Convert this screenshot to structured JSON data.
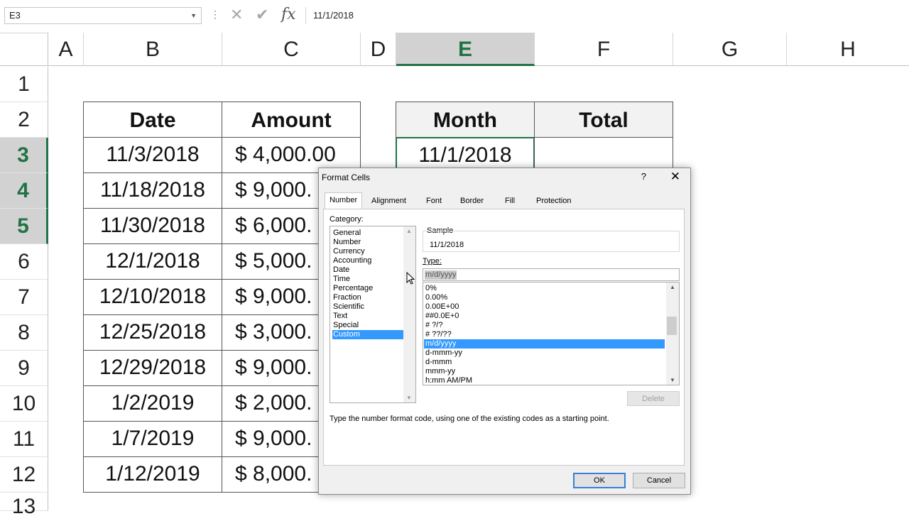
{
  "formula_bar": {
    "name_box": "E3",
    "formula": "11/1/2018",
    "icons": [
      "more-icon",
      "cancel-icon",
      "enter-icon",
      "fx-icon"
    ]
  },
  "columns": [
    "A",
    "B",
    "C",
    "D",
    "E",
    "F",
    "G",
    "H"
  ],
  "selected_column": "E",
  "rows": [
    "1",
    "2",
    "3",
    "4",
    "5",
    "6",
    "7",
    "8",
    "9",
    "10",
    "11",
    "12",
    "13"
  ],
  "selected_rows": [
    "3",
    "4",
    "5"
  ],
  "table": {
    "headers": [
      "Date",
      "Amount"
    ],
    "rows": [
      {
        "date": "11/3/2018",
        "amount": "$ 4,000.00"
      },
      {
        "date": "11/18/2018",
        "amount": "$ 9,000."
      },
      {
        "date": "11/30/2018",
        "amount": "$ 6,000."
      },
      {
        "date": "12/1/2018",
        "amount": "$ 5,000."
      },
      {
        "date": "12/10/2018",
        "amount": "$ 9,000."
      },
      {
        "date": "12/25/2018",
        "amount": "$ 3,000."
      },
      {
        "date": "12/29/2018",
        "amount": "$ 9,000."
      },
      {
        "date": "1/2/2019",
        "amount": "$ 2,000."
      },
      {
        "date": "1/7/2019",
        "amount": "$ 9,000."
      },
      {
        "date": "1/12/2019",
        "amount": "$ 8,000."
      }
    ]
  },
  "summary": {
    "headers": [
      "Month",
      "Total"
    ],
    "month_value": "11/1/2018",
    "total_value": ""
  },
  "dialog": {
    "title": "Format Cells",
    "help": "?",
    "close": "✕",
    "tabs": [
      "Number",
      "Alignment",
      "Font",
      "Border",
      "Fill",
      "Protection"
    ],
    "active_tab": "Number",
    "category_label": "Category:",
    "categories": [
      "General",
      "Number",
      "Currency",
      "Accounting",
      "Date",
      "Time",
      "Percentage",
      "Fraction",
      "Scientific",
      "Text",
      "Special",
      "Custom"
    ],
    "selected_category": "Custom",
    "sample_label": "Sample",
    "sample_value": "11/1/2018",
    "type_label": "Type:",
    "type_value": "m/d/yyyy",
    "formats": [
      "0%",
      "0.00%",
      "0.00E+00",
      "##0.0E+0",
      "# ?/?",
      "# ??/??",
      "m/d/yyyy",
      "d-mmm-yy",
      "d-mmm",
      "mmm-yy",
      "h:mm AM/PM"
    ],
    "selected_format": "m/d/yyyy",
    "delete_label": "Delete",
    "hint": "Type the number format code, using one of the existing codes as a starting point.",
    "ok_label": "OK",
    "cancel_label": "Cancel"
  },
  "colors": {
    "accent": "#217346",
    "selection": "#3399ff",
    "header_grey": "#d2d2d2"
  }
}
